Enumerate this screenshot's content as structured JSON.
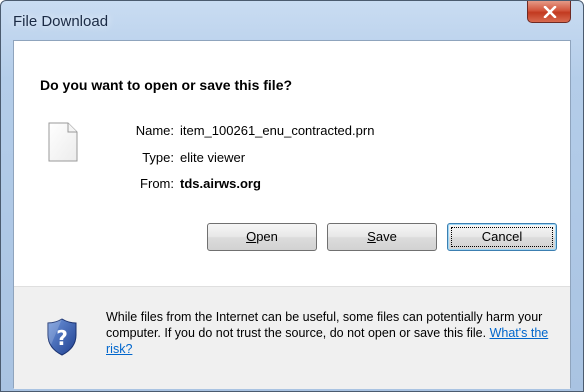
{
  "window": {
    "title": "File Download"
  },
  "dialog": {
    "question": "Do you want to open or save this file?",
    "file_icon": "blank-document-icon",
    "fields": {
      "name_label": "Name:",
      "name_value": "item_100261_enu_contracted.prn",
      "type_label": "Type:",
      "type_value": "elite viewer",
      "from_label": "From:",
      "from_value": "tds.airws.org"
    },
    "buttons": {
      "open_label": "Open",
      "open_access_key": "O",
      "save_label": "Save",
      "save_access_key": "S",
      "cancel_label": "Cancel"
    }
  },
  "footer": {
    "icon": "shield-question-icon",
    "warning_text": "While files from the Internet can be useful, some files can potentially harm your computer. If you do not trust the source, do not open or save this file.",
    "risk_link": "What's the risk?"
  },
  "colors": {
    "titlebar": "#b4cde9",
    "close_button": "#c23a20",
    "footer_bg": "#f0f0f0",
    "link": "#0066cc",
    "shield": "#2f57a7"
  }
}
